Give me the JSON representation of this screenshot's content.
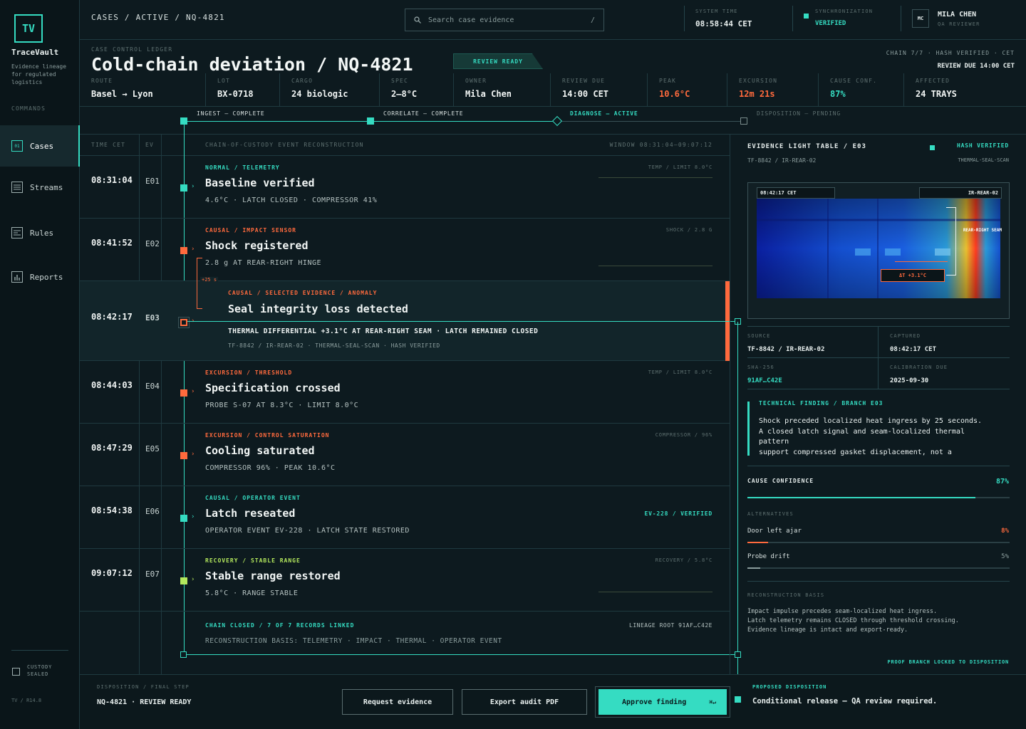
{
  "brand": {
    "logo": "TV",
    "name": "TraceVault",
    "tagline": "Evidence lineage for regulated logistics",
    "commands_label": "COMMANDS",
    "version": "TV / R14.8",
    "custody": "CUSTODY SEALED"
  },
  "nav": [
    {
      "badge": "01",
      "label": "Cases",
      "icon": "cases-icon"
    },
    {
      "badge": "",
      "label": "Streams",
      "icon": "streams-icon"
    },
    {
      "badge": "",
      "label": "Rules",
      "icon": "rules-icon"
    },
    {
      "badge": "",
      "label": "Reports",
      "icon": "reports-icon"
    }
  ],
  "topbar": {
    "breadcrumb": "CASES / ACTIVE / NQ-4821",
    "search_placeholder": "Search case evidence",
    "search_shortcut": "/",
    "system_time_label": "SYSTEM TIME",
    "system_time": "08:58:44 CET",
    "sync_label": "SYNCHRONIZATION",
    "sync_value": "VERIFIED",
    "user_initials": "MC",
    "user_name": "MILA CHEN",
    "user_role": "QA REVIEWER"
  },
  "case": {
    "ledger_label": "CASE CONTROL LEDGER",
    "title": "Cold-chain deviation / NQ-4821",
    "status_badge": "REVIEW READY",
    "chain_info": "CHAIN 7/7 · HASH VERIFIED · CET",
    "review_due_info": "REVIEW DUE 14:00 CET",
    "metrics": [
      {
        "label": "ROUTE",
        "value": "Basel → Lyon",
        "color": ""
      },
      {
        "label": "LOT",
        "value": "BX-0718",
        "color": ""
      },
      {
        "label": "CARGO",
        "value": "24 biologic",
        "color": ""
      },
      {
        "label": "SPEC",
        "value": "2–8°C",
        "color": ""
      },
      {
        "label": "OWNER",
        "value": "Mila Chen",
        "color": ""
      },
      {
        "label": "REVIEW DUE",
        "value": "14:00 CET",
        "color": ""
      },
      {
        "label": "PEAK",
        "value": "10.6°C",
        "color": "#ff6a3d"
      },
      {
        "label": "EXCURSION",
        "value": "12m 21s",
        "color": "#ff6a3d"
      },
      {
        "label": "CAUSE CONF.",
        "value": "87%",
        "color": "#35dcc2"
      },
      {
        "label": "AFFECTED",
        "value": "24 TRAYS",
        "color": ""
      }
    ]
  },
  "stages": [
    {
      "label": "INGEST — COMPLETE",
      "state": "complete"
    },
    {
      "label": "CORRELATE — COMPLETE",
      "state": "complete"
    },
    {
      "label": "DIAGNOSE — ACTIVE",
      "state": "active"
    },
    {
      "label": "DISPOSITION — PENDING",
      "state": "pending"
    }
  ],
  "timeline": {
    "col_time": "TIME CET",
    "col_ev": "EV",
    "col_title": "CHAIN-OF-CUSTODY EVENT RECONSTRUCTION",
    "window": "WINDOW 08:31:04–09:07:12",
    "offset_label": "+25 s",
    "events": [
      {
        "time": "08:31:04",
        "ev": "E01",
        "category": "NORMAL / TELEMETRY",
        "title": "Baseline verified",
        "detail": "4.6°C · LATCH CLOSED · COMPRESSOR 41%",
        "meta": "TEMP / LIMIT 8.0°C",
        "color": "#35dcc2"
      },
      {
        "time": "08:41:52",
        "ev": "E02",
        "category": "CAUSAL / IMPACT SENSOR",
        "title": "Shock registered",
        "detail": "2.8 g AT REAR-RIGHT HINGE",
        "meta": "SHOCK / 2.8 g",
        "color": "#ff6a3d"
      },
      {
        "time": "08:42:17",
        "ev": "E03",
        "category": "CAUSAL / SELECTED EVIDENCE / ANOMALY",
        "title": "Seal integrity loss detected",
        "detail": "THERMAL DIFFERENTIAL +3.1°C AT REAR-RIGHT SEAM · LATCH REMAINED CLOSED",
        "sub": "TF-8842 / IR-REAR-02 · THERMAL-SEAL-SCAN · HASH VERIFIED",
        "meta": "",
        "color": "#ff6a3d"
      },
      {
        "time": "08:44:03",
        "ev": "E04",
        "category": "EXCURSION / THRESHOLD",
        "title": "Specification crossed",
        "detail": "PROBE S-07 AT 8.3°C · LIMIT 8.0°C",
        "meta": "TEMP / LIMIT 8.0°C",
        "color": "#ff6a3d"
      },
      {
        "time": "08:47:29",
        "ev": "E05",
        "category": "EXCURSION / CONTROL SATURATION",
        "title": "Cooling saturated",
        "detail": "COMPRESSOR 96% · PEAK 10.6°C",
        "meta": "COMPRESSOR / 96%",
        "color": "#ff6a3d"
      },
      {
        "time": "08:54:38",
        "ev": "E06",
        "category": "CAUSAL / OPERATOR EVENT",
        "title": "Latch reseated",
        "detail": "OPERATOR EVENT EV-228 · LATCH STATE RESTORED",
        "meta": "EV-228 / VERIFIED",
        "color": "#35dcc2"
      },
      {
        "time": "09:07:12",
        "ev": "E07",
        "category": "RECOVERY / STABLE RANGE",
        "title": "Stable range restored",
        "detail": "5.8°C · RANGE STABLE",
        "meta": "RECOVERY / 5.8°C",
        "color": "#b4e85d"
      }
    ],
    "chain_closed": "CHAIN CLOSED / 7 OF 7 RECORDS LINKED",
    "lineage_root": "LINEAGE ROOT 91AF…C42E",
    "basis": "RECONSTRUCTION BASIS: TELEMETRY · IMPACT · THERMAL · OPERATOR EVENT"
  },
  "evidence": {
    "title": "EVIDENCE LIGHT TABLE / E03",
    "subtitle": "TF-8842 / IR-REAR-02",
    "hash": "HASH VERIFIED",
    "scan": "THERMAL-SEAL-SCAN",
    "img_time": "08:42:17 CET",
    "img_cam": "IR-REAR-02",
    "img_seam": "REAR-RIGHT SEAM",
    "img_delta": "ΔT +3.1°C",
    "fields": [
      {
        "label": "SOURCE",
        "value": "TF-8842 / IR-REAR-02",
        "color": ""
      },
      {
        "label": "CAPTURED",
        "value": "08:42:17 CET",
        "color": ""
      },
      {
        "label": "SHA-256",
        "value": "91AF…C42E",
        "color": "#35dcc2"
      },
      {
        "label": "CALIBRATION DUE",
        "value": "2025-09-30",
        "color": ""
      }
    ],
    "finding_label": "TECHNICAL FINDING / BRANCH E03",
    "finding_lines": [
      "Shock preceded localized heat ingress by 25 seconds.",
      "A closed latch signal and seam-localized thermal",
      "pattern",
      "support compressed gasket displacement, not a"
    ],
    "confidence_label": "CAUSE CONFIDENCE",
    "confidence_value": "87%",
    "confidence": 0.87,
    "alternatives_label": "ALTERNATIVES",
    "alternatives": [
      {
        "label": "Door left ajar",
        "value": "8%",
        "fraction": 0.08,
        "color": "#ff6a3d"
      },
      {
        "label": "Probe drift",
        "value": "5%",
        "fraction": 0.05,
        "color": "#8a9c9c"
      }
    ],
    "basis_label": "RECONSTRUCTION BASIS",
    "basis_lines": [
      "Impact impulse precedes seam-localized heat ingress.",
      "Latch telemetry remains CLOSED through threshold crossing.",
      "Evidence lineage is intact and export-ready."
    ],
    "locked": "PROOF BRANCH LOCKED TO DISPOSITION"
  },
  "footer": {
    "step_label": "DISPOSITION / FINAL STEP",
    "step_value": "NQ-4821 · REVIEW READY",
    "btn_request": "Request evidence",
    "btn_export": "Export audit PDF",
    "btn_approve": "Approve finding",
    "approve_shortcut": "⌘↵",
    "proposed_label": "PROPOSED DISPOSITION",
    "proposed_value": "Conditional release — QA review required."
  }
}
